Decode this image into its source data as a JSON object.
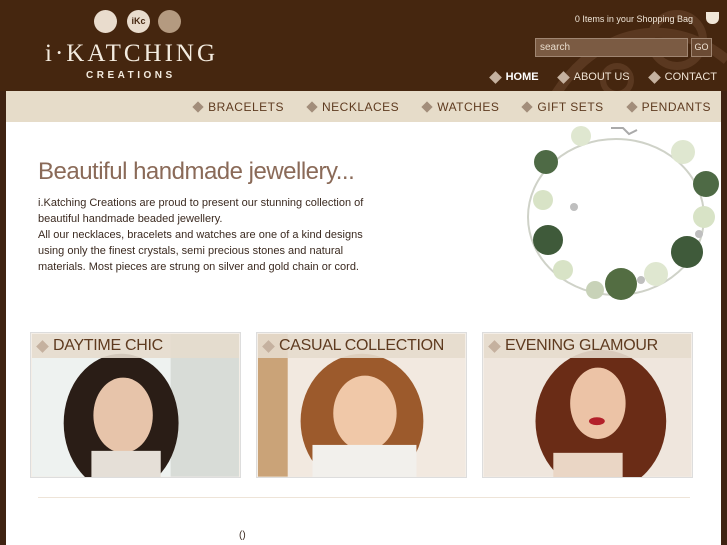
{
  "brand": {
    "name": "i·KATCHING",
    "tagline": "CREATIONS",
    "badge": "iKc"
  },
  "bag": {
    "text": "0 Items in your  Shopping Bag"
  },
  "search": {
    "value": "search",
    "button": "GO"
  },
  "topnav": [
    {
      "label": "HOME",
      "active": true
    },
    {
      "label": "ABOUT US",
      "active": false
    },
    {
      "label": "CONTACT",
      "active": false
    }
  ],
  "categories": [
    "BRACELETS",
    "NECKLACES",
    "WATCHES",
    "GIFT SETS",
    "PENDANTS"
  ],
  "intro": {
    "heading": "Beautiful handmade jewellery...",
    "para1": "i.Katching Creations are proud to present our stunning collection of beautiful handmade beaded jewellery.",
    "para2": "All our necklaces, bracelets and watches are one of a kind designs using only the finest crystals, semi precious stones and natural materials. Most pieces are strung on silver and gold chain or cord."
  },
  "collections": [
    {
      "title": "DAYTIME CHIC"
    },
    {
      "title": "CASUAL COLLECTION"
    },
    {
      "title": "EVENING GLAMOUR"
    }
  ],
  "footer": {
    "text": "()"
  },
  "colors": {
    "header": "#45260f",
    "catbar": "#e6dcc9",
    "accent": "#8a6a58"
  }
}
